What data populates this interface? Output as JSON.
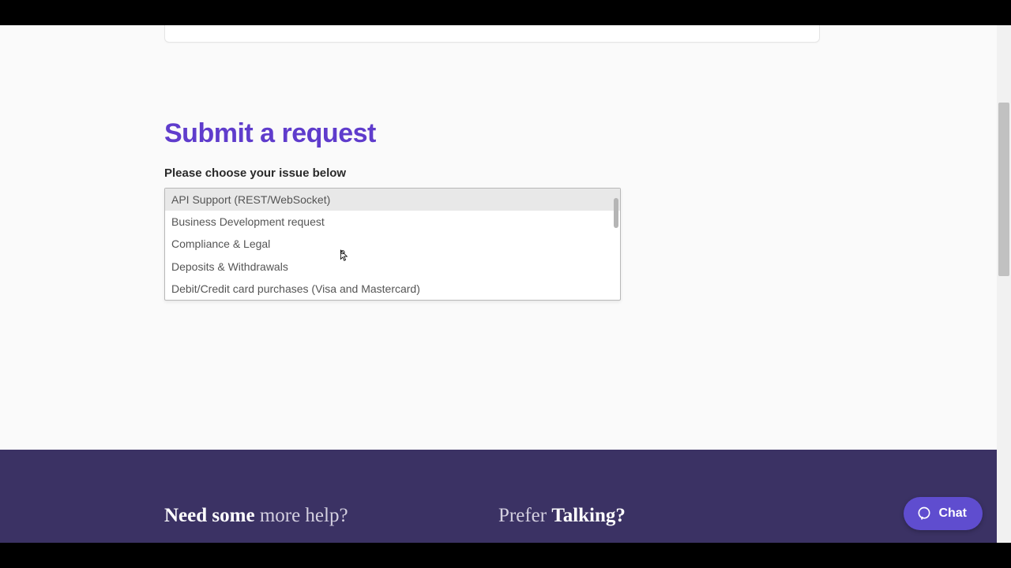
{
  "title": "Submit a request",
  "field_label": "Please choose your issue below",
  "dropdown": {
    "options": [
      "API Support (REST/WebSocket)",
      "Business Development request",
      "Compliance & Legal",
      "Deposits & Withdrawals",
      "Debit/Credit card purchases (Visa and Mastercard)"
    ],
    "highlighted_index": 0
  },
  "footer": {
    "left_bold": "Need some",
    "left_light": " more help?",
    "right_light": "Prefer ",
    "right_bold": "Talking?"
  },
  "chat_label": "Chat"
}
